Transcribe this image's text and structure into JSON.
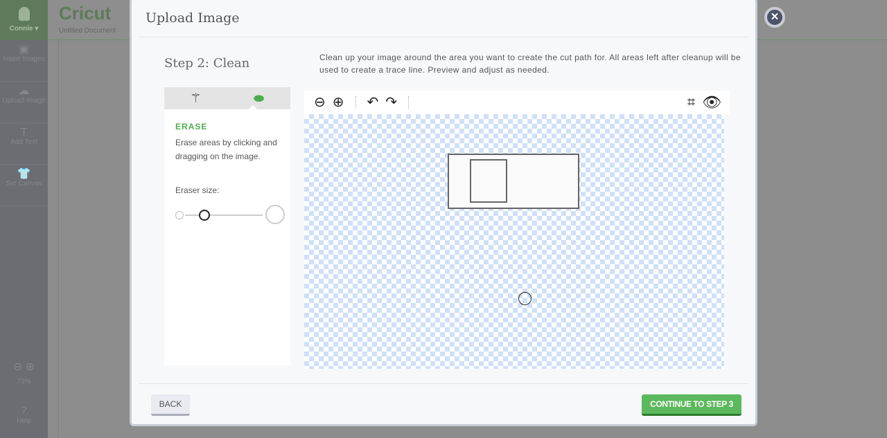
{
  "sidebar": {
    "user": "Connie ▾",
    "items": [
      {
        "label": "Insert Images",
        "icon": "image-icon"
      },
      {
        "label": "Upload Image",
        "icon": "cloud-upload-icon"
      },
      {
        "label": "Add Text",
        "icon": "text-icon"
      },
      {
        "label": "Set Canvas",
        "icon": "shirt-icon"
      }
    ],
    "zoom": "73%",
    "help": "Help"
  },
  "header": {
    "logo": "Cricut",
    "document": "Untitled Document"
  },
  "modal": {
    "title": "Upload Image",
    "step": "Step 2: Clean",
    "instructions": "Clean up your image around the area you want to create the cut path for. All areas left after cleanup will be used to create a trace line. Preview and adjust as needed.",
    "panel": {
      "tabs": [
        {
          "icon": "magic-wand-icon",
          "active": false
        },
        {
          "icon": "eraser-icon",
          "active": true
        }
      ],
      "heading": "ERASE",
      "description": "Erase areas by clicking and dragging on the image.",
      "eraser_label": "Eraser size:",
      "eraser_size": 0.25
    },
    "toolbar": {
      "zoom_out": "zoom-out-icon",
      "zoom_in": "zoom-in-icon",
      "undo": "undo-icon",
      "redo": "redo-icon",
      "crop": "crop-icon",
      "preview": "eye-icon"
    },
    "back": "BACK",
    "continue": "CONTINUE TO STEP 3"
  },
  "colors": {
    "accent": "#5cb85c",
    "checker": "#cfe0f7"
  }
}
